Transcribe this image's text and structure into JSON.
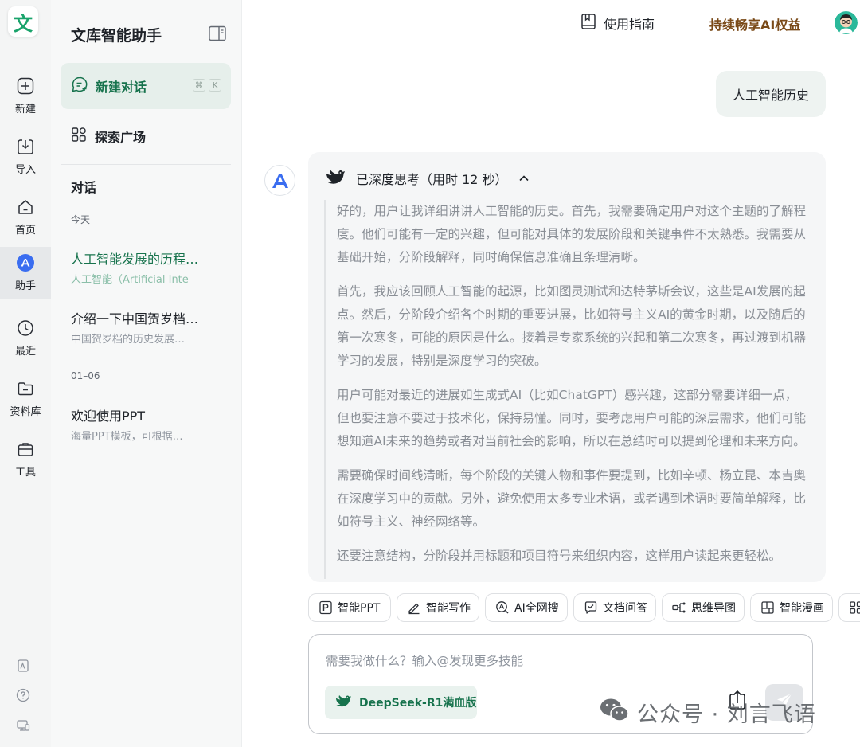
{
  "app": {
    "logo_char": "文",
    "title": "文库智能助手",
    "accent": "#17734d",
    "accent_bg": "#e6efeb"
  },
  "rail": {
    "items": [
      {
        "label": "新建",
        "icon": "plus-icon"
      },
      {
        "label": "导入",
        "icon": "import-icon"
      },
      {
        "label": "首页",
        "icon": "home-icon"
      },
      {
        "label": "助手",
        "icon": "assistant-icon"
      },
      {
        "label": "最近",
        "icon": "clock-icon"
      },
      {
        "label": "资料库",
        "icon": "folder-icon"
      },
      {
        "label": "工具",
        "icon": "toolbox-icon"
      }
    ],
    "active_index": 3
  },
  "sidebar": {
    "new_chat_label": "新建对话",
    "shortcut_keys": [
      "⌘",
      "K"
    ],
    "explore_label": "探索广场",
    "section_title": "对话",
    "groups": [
      {
        "date": "今天",
        "conversations": [
          {
            "title": "人工智能发展的历程…",
            "subtitle": "人工智能（Artificial Inte"
          },
          {
            "title": "介绍一下中国贺岁档…",
            "subtitle": "中国贺岁档的历史发展…"
          }
        ]
      },
      {
        "date": "01–06",
        "conversations": [
          {
            "title": "欢迎使用PPT",
            "subtitle": "海量PPT模板，可根据…"
          }
        ]
      }
    ]
  },
  "header": {
    "guide_label": "使用指南",
    "premium_label": "持续畅享AI权益"
  },
  "chat": {
    "user_message": "人工智能历史",
    "thinking_label": "已深度思考（用时 12 秒）",
    "thinking_paragraphs": [
      "好的，用户让我详细讲讲人工智能的历史。首先，我需要确定用户对这个主题的了解程度。他们可能有一定的兴趣，但可能对具体的发展阶段和关键事件不太熟悉。我需要从基础开始，分阶段解释，同时确保信息准确且条理清晰。",
      "首先，我应该回顾人工智能的起源，比如图灵测试和达特茅斯会议，这些是AI发展的起点。然后，分阶段介绍各个时期的重要进展，比如符号主义AI的黄金时期，以及随后的第一次寒冬，可能的原因是什么。接着是专家系统的兴起和第二次寒冬，再过渡到机器学习的发展，特别是深度学习的突破。",
      "用户可能对最近的进展如生成式AI（比如ChatGPT）感兴趣，这部分需要详细一点，但也要注意不要过于技术化，保持易懂。同时，要考虑用户可能的深层需求，他们可能想知道AI未来的趋势或者对当前社会的影响，所以在总结时可以提到伦理和未来方向。",
      "需要确保时间线清晰，每个阶段的关键人物和事件要提到，比如辛顿、杨立昆、本吉奥在深度学习中的贡献。另外，避免使用太多专业术语，或者遇到术语时要简单解释，比如符号主义、神经网络等。",
      "还要注意结构，分阶段并用标题和项目符号来组织内容，这样用户读起来更轻松。"
    ]
  },
  "skills": [
    {
      "label": "智能PPT",
      "icon": "ppt-icon"
    },
    {
      "label": "智能写作",
      "icon": "pen-icon"
    },
    {
      "label": "AI全网搜",
      "icon": "ai-search-icon"
    },
    {
      "label": "文档问答",
      "icon": "doc-qa-icon"
    },
    {
      "label": "思维导图",
      "icon": "mindmap-icon"
    },
    {
      "label": "智能漫画",
      "icon": "comic-icon"
    },
    {
      "label": "",
      "icon": "grid-icon"
    }
  ],
  "composer": {
    "placeholder": "需要我做什么？输入@发现更多技能",
    "value": "",
    "model_label": "DeepSeek-R1满血版"
  },
  "watermark": {
    "text": "公众号 · 刘言飞语"
  }
}
